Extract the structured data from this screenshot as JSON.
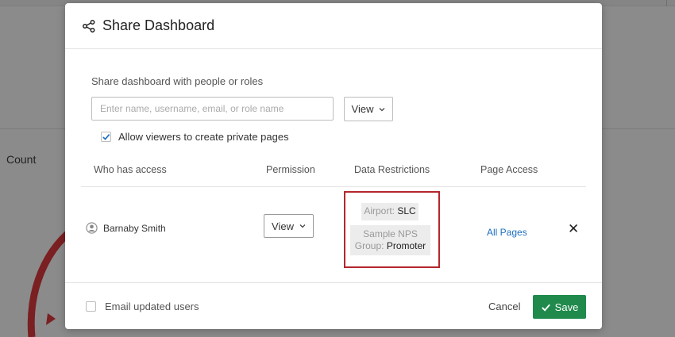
{
  "background": {
    "label": "Count"
  },
  "modal": {
    "title": "Share Dashboard",
    "icon": "share-icon",
    "share_label": "Share dashboard with people or roles",
    "search": {
      "placeholder": "Enter name, username, email, or role name",
      "value": ""
    },
    "new_permission": "View",
    "allow_private_pages": {
      "label": "Allow viewers to create private pages",
      "checked": true
    },
    "columns": [
      "Who has access",
      "Permission",
      "Data Restrictions",
      "Page Access"
    ],
    "rows": [
      {
        "name": "Barnaby Smith",
        "permission": "View",
        "restrictions": [
          {
            "field": "Airport:",
            "value": "SLC"
          },
          {
            "field_line1": "Sample NPS",
            "field_line2": "Group:",
            "value": "Promoter"
          }
        ],
        "page_access": "All Pages"
      }
    ],
    "footer": {
      "email_label": "Email updated users",
      "email_checked": false,
      "cancel": "Cancel",
      "save": "Save"
    }
  },
  "colors": {
    "save": "#1f8a4c",
    "link": "#1d6fbe",
    "highlight": "#b5262d",
    "checkbox_accent": "#1d6fbe"
  }
}
